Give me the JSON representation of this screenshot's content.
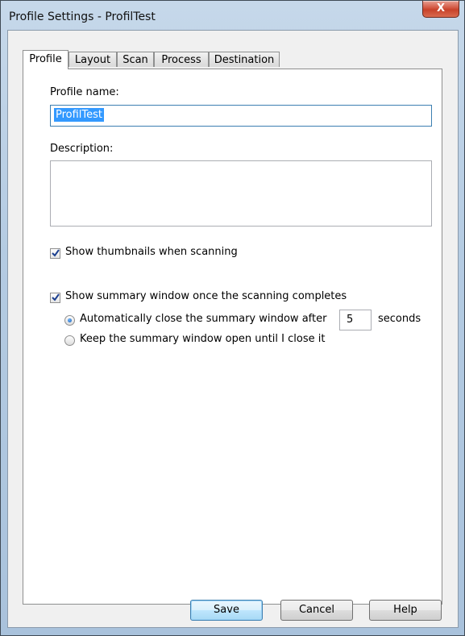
{
  "window": {
    "title": "Profile Settings - ProfilTest",
    "close_glyph": "X"
  },
  "tabs": [
    {
      "label": "Profile",
      "active": true
    },
    {
      "label": "Layout",
      "active": false
    },
    {
      "label": "Scan",
      "active": false
    },
    {
      "label": "Process",
      "active": false
    },
    {
      "label": "Destination",
      "active": false
    }
  ],
  "profile": {
    "name_label": "Profile name:",
    "name_value": "ProfilTest",
    "description_label": "Description:",
    "description_value": "",
    "show_thumbnails": {
      "label": "Show thumbnails when scanning",
      "checked": true
    },
    "show_summary": {
      "label": "Show summary window once the scanning completes",
      "checked": true
    },
    "auto_close": {
      "label": "Automatically close the summary window after",
      "seconds_value": "5",
      "seconds_label": "seconds",
      "selected": true
    },
    "keep_open": {
      "label": "Keep the summary window open until I close it",
      "selected": false
    }
  },
  "buttons": {
    "save": "Save",
    "cancel": "Cancel",
    "help": "Help"
  },
  "colors": {
    "accent": "#3399ff",
    "close": "#c7422a"
  }
}
